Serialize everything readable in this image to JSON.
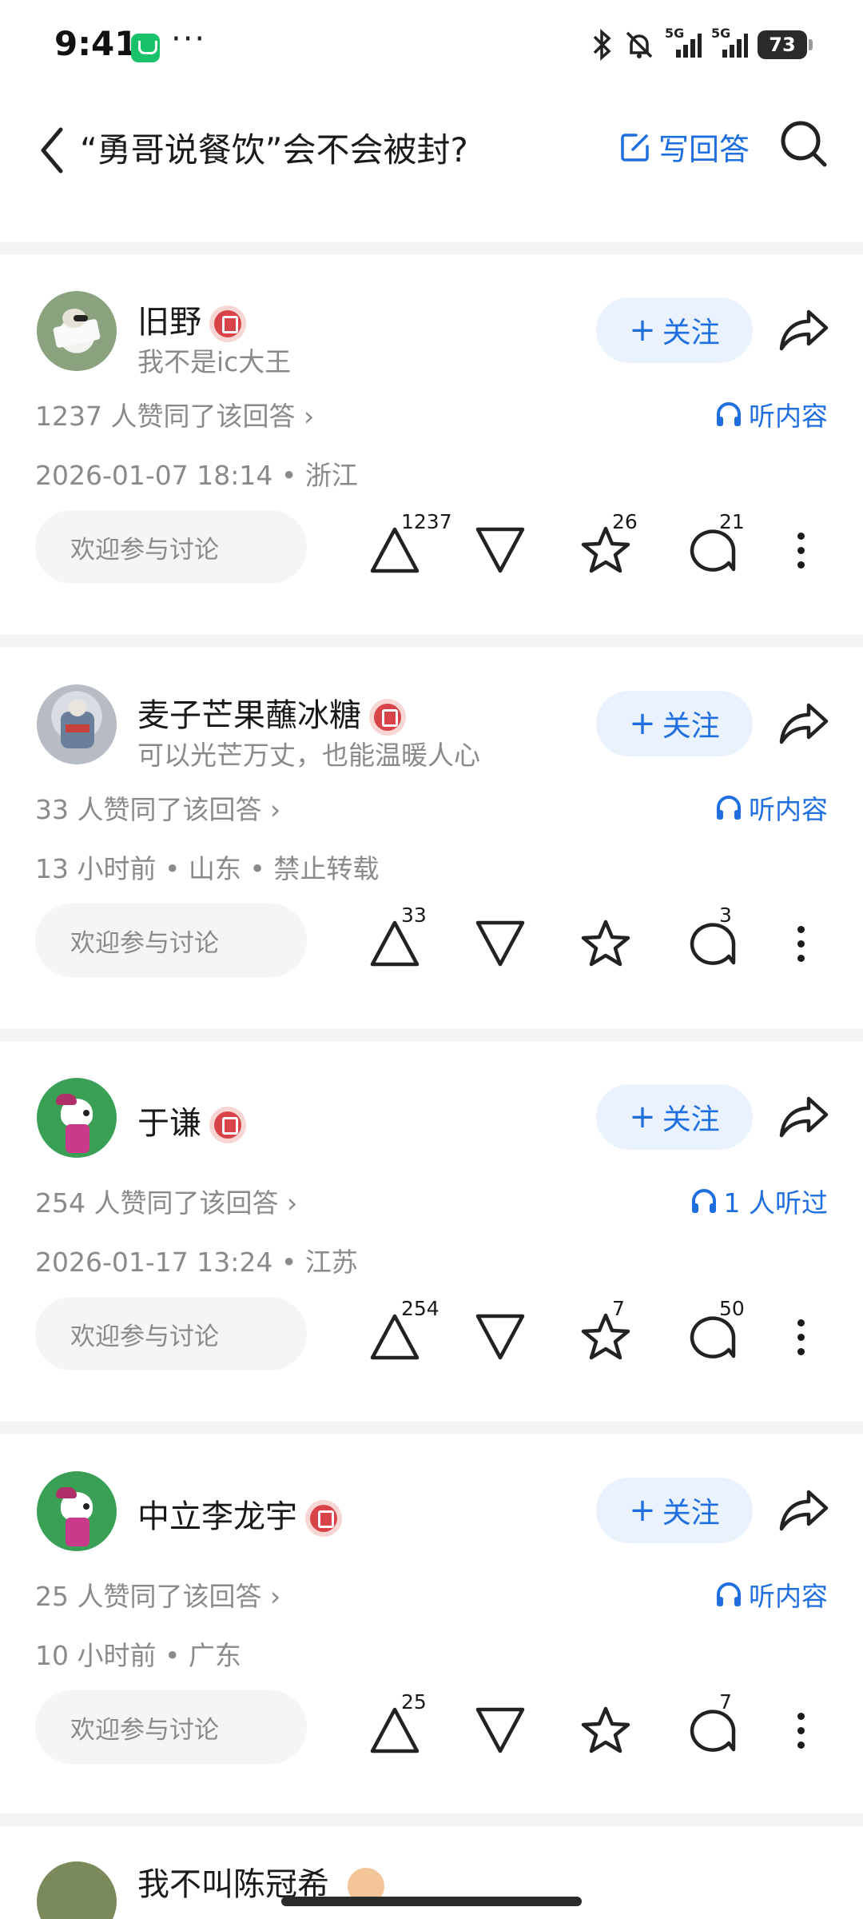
{
  "status_bar": {
    "time": "9:41",
    "more": "···",
    "net1": "5G",
    "net2": "5G",
    "battery": "73"
  },
  "header": {
    "title": "“勇哥说餐饮”会不会被封?",
    "write_label": "写回答"
  },
  "answers": [
    {
      "name": "旧野",
      "bio": "我不是ic大王",
      "follow": "关注",
      "agree": "1237 人赞同了该回答 ›",
      "listen": "听内容",
      "meta": "2026-01-07 18:14 • 浙江",
      "discuss": "欢迎参与讨论",
      "up_count": "1237",
      "star_count": "26",
      "comment_count": "21"
    },
    {
      "name": "麦子芒果蘸冰糖",
      "bio": "可以光芒万丈，也能温暖人心",
      "follow": "关注",
      "agree": "33 人赞同了该回答 ›",
      "listen": "听内容",
      "meta": "13 小时前 • 山东 • 禁止转载",
      "discuss": "欢迎参与讨论",
      "up_count": "33",
      "star_count": "",
      "comment_count": "3"
    },
    {
      "name": "于谦",
      "bio": "",
      "follow": "关注",
      "agree": "254 人赞同了该回答 ›",
      "listen": "1 人听过",
      "meta": "2026-01-17 13:24 • 江苏",
      "discuss": "欢迎参与讨论",
      "up_count": "254",
      "star_count": "7",
      "comment_count": "50"
    },
    {
      "name": "中立李龙宇",
      "bio": "",
      "follow": "关注",
      "agree": "25 人赞同了该回答 ›",
      "listen": "听内容",
      "meta": "10 小时前 • 广东",
      "discuss": "欢迎参与讨论",
      "up_count": "25",
      "star_count": "",
      "comment_count": "7"
    }
  ],
  "partial": {
    "name": "我不叫陈冠希"
  },
  "colors": {
    "accent": "#1f6fe0",
    "follow_bg": "#eaf2fd",
    "muted_text": "#8a8a8a",
    "badge_red": "#d8434a"
  }
}
